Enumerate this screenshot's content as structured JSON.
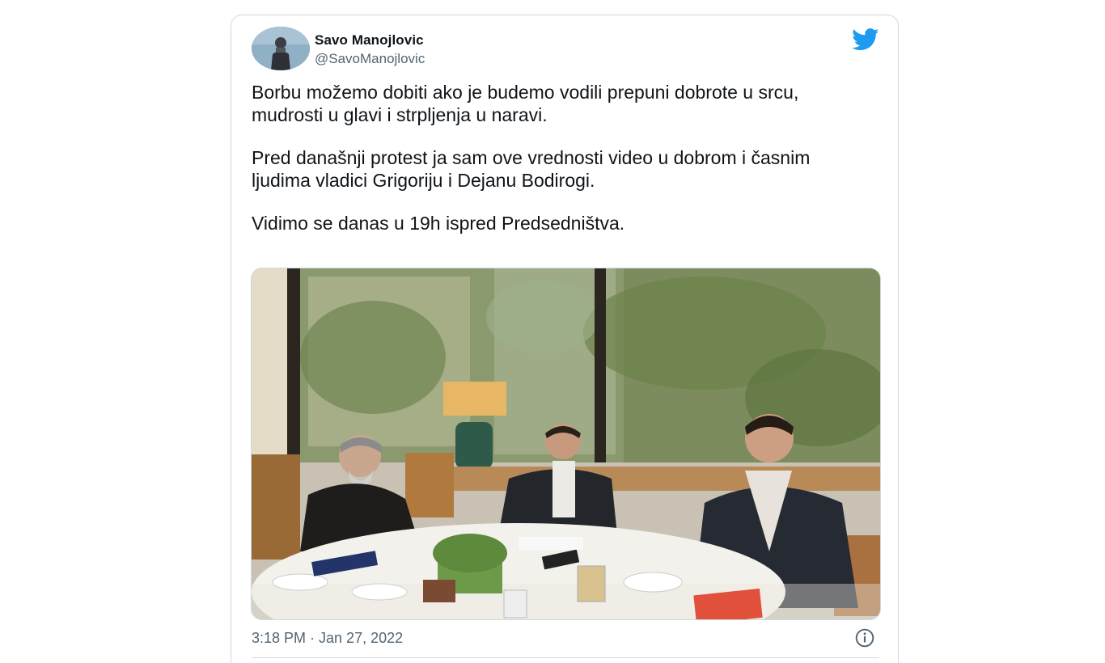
{
  "author": {
    "name": "Savo Manojlovic",
    "handle": "@SavoManojlovic"
  },
  "tweet": {
    "paragraphs": [
      "Borbu možemo dobiti ako je budemo vodili prepuni dobrote u srcu, mudrosti u glavi i strpljenja u naravi.",
      "Pred današnji protest ja sam ove vrednosti video u dobrom i časnim ljudima vladici Grigoriju i Dejanu Bodirogi.",
      "Vidimo se danas u 19h ispred Predsedništva."
    ],
    "timestamp": "3:18 PM · Jan 27, 2022"
  },
  "icons": {
    "brand": "twitter-bird-icon",
    "info": "info-icon"
  },
  "colors": {
    "twitter_blue": "#1d9bf0",
    "secondary_text": "#536471",
    "border": "#cfd9de"
  }
}
